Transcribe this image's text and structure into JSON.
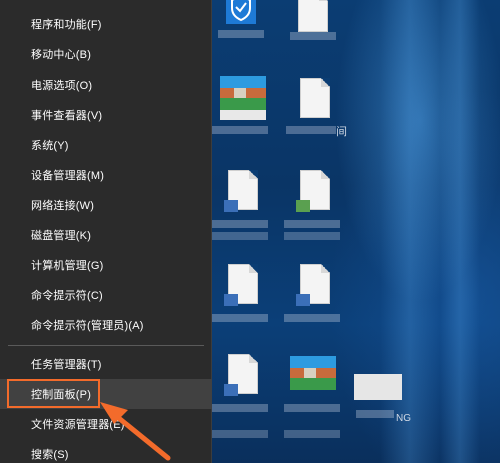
{
  "winx_menu": {
    "items": [
      {
        "label": "程序和功能(F)"
      },
      {
        "label": "移动中心(B)"
      },
      {
        "label": "电源选项(O)"
      },
      {
        "label": "事件查看器(V)"
      },
      {
        "label": "系统(Y)"
      },
      {
        "label": "设备管理器(M)"
      },
      {
        "label": "网络连接(W)"
      },
      {
        "label": "磁盘管理(K)"
      },
      {
        "label": "计算机管理(G)"
      },
      {
        "label": "命令提示符(C)"
      },
      {
        "label": "命令提示符(管理员)(A)"
      },
      {
        "label": "任务管理器(T)"
      },
      {
        "label": "控制面板(P)"
      },
      {
        "label": "文件资源管理器(E)"
      },
      {
        "label": "搜索(S)"
      }
    ],
    "highlighted_item": "控制面板(P)"
  },
  "desktop": {
    "partial_label_1": "间",
    "partial_label_2": "NG"
  },
  "colors": {
    "menu_bg": "#2b2b2b",
    "menu_hover": "#414141",
    "annotation": "#f36b2b",
    "desktop_bg": "#0b3d73"
  }
}
